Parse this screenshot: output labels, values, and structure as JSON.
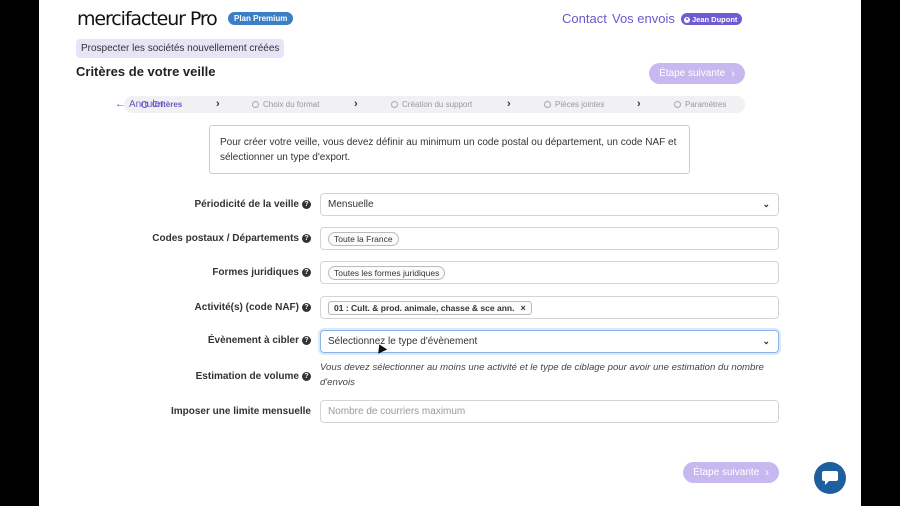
{
  "header": {
    "logo": "mercifacteur Pro",
    "plan_badge": "Plan Premium",
    "nav_contact": "Contact",
    "nav_envois": "Vos envois",
    "user_name": "Jean Dupont"
  },
  "breadcrumb": "Prospecter les sociétés nouvellement créées",
  "page_title": "Critères de votre veille",
  "next_button": "Étape suivante",
  "cancel_label": "Annuler",
  "steps": [
    {
      "label": "Critères",
      "active": true
    },
    {
      "label": "Choix du format",
      "active": false
    },
    {
      "label": "Création du support",
      "active": false
    },
    {
      "label": "Pièces jointes",
      "active": false
    },
    {
      "label": "Paramètres",
      "active": false
    }
  ],
  "info_text": "Pour créer votre veille, vous devez définir au minimum un code postal ou département, un code NAF et sélectionner un type d'export.",
  "form": {
    "periodicite": {
      "label": "Périodicité de la veille",
      "value": "Mensuelle"
    },
    "codes_postaux": {
      "label": "Codes postaux / Départements",
      "tag": "Toute la France"
    },
    "formes_juridiques": {
      "label": "Formes juridiques",
      "tag": "Toutes les formes juridiques"
    },
    "activites": {
      "label": "Activité(s) (code NAF)",
      "tag": "01 : Cult. & prod. animale, chasse & sce ann.",
      "remove": "×"
    },
    "evenement": {
      "label": "Évènement à cibler",
      "value": "Sélectionnez le type d'évènement"
    },
    "estimation": {
      "label": "Estimation de volume",
      "text": "Vous devez sélectionner au moins une activité et le type de ciblage pour avoir une estimation du nombre d'envois"
    },
    "limite": {
      "label": "Imposer une limite mensuelle",
      "placeholder": "Nombre de courriers maximum"
    }
  },
  "icons": {
    "help": "question-circle-icon",
    "chat": "chat-icon",
    "user": "user-icon"
  },
  "colors": {
    "accent": "#6a58c8",
    "next_button": "#c7b9f0",
    "plan_badge": "#3d7fc4",
    "chat": "#1e5f9e"
  }
}
